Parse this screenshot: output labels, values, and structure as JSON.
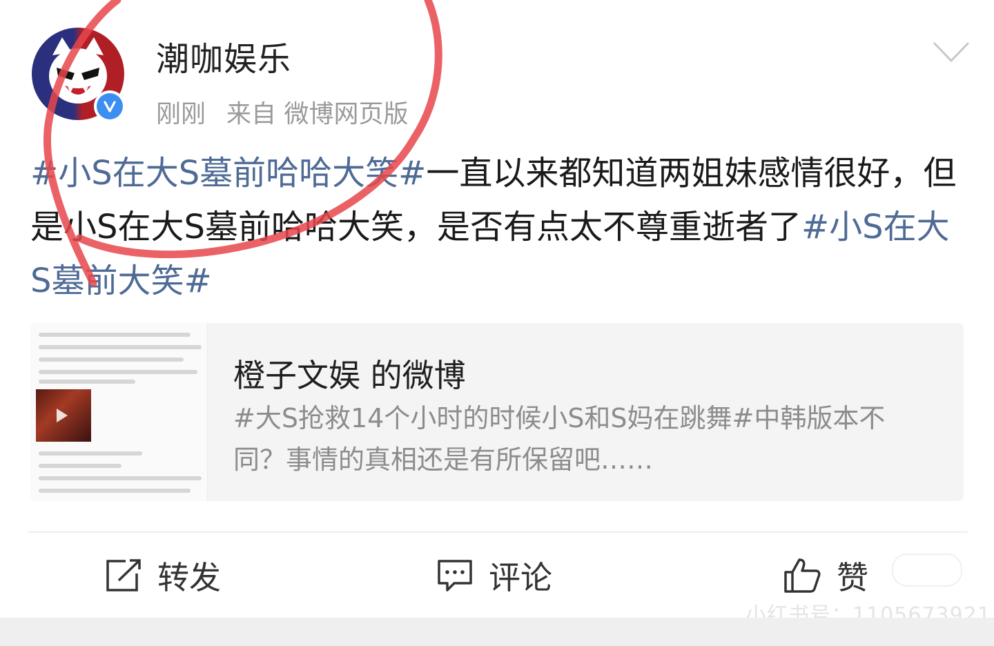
{
  "post": {
    "author": "潮咖娱乐",
    "time": "刚刚",
    "source": "来自 微博网页版",
    "text": {
      "tag1": "#小S在大S墓前哈哈大笑#",
      "body": "一直以来都知道两姐妹感情很好，但是小S在大S墓前哈哈大笑，是否有点太不尊重逝者了",
      "tag2": "#小S在大S墓前大笑#"
    }
  },
  "quoted": {
    "title": "橙子文娱 的微博",
    "text": "#大S抢救14个小时的时候小S和S妈在跳舞#中韩版本不同？事情的真相还是有所保留吧……"
  },
  "actions": {
    "repost": "转发",
    "comment": "评论",
    "like": "赞"
  },
  "watermark": "小红书号：1105673921",
  "colors": {
    "hashtag": "#4e6a95",
    "annotation_circle": "#e8474b",
    "verified_badge": "#3b8ff0"
  },
  "icons": [
    "cat-avatar-icon",
    "verified-icon",
    "chevron-down-icon",
    "repost-icon",
    "comment-icon",
    "like-icon"
  ]
}
